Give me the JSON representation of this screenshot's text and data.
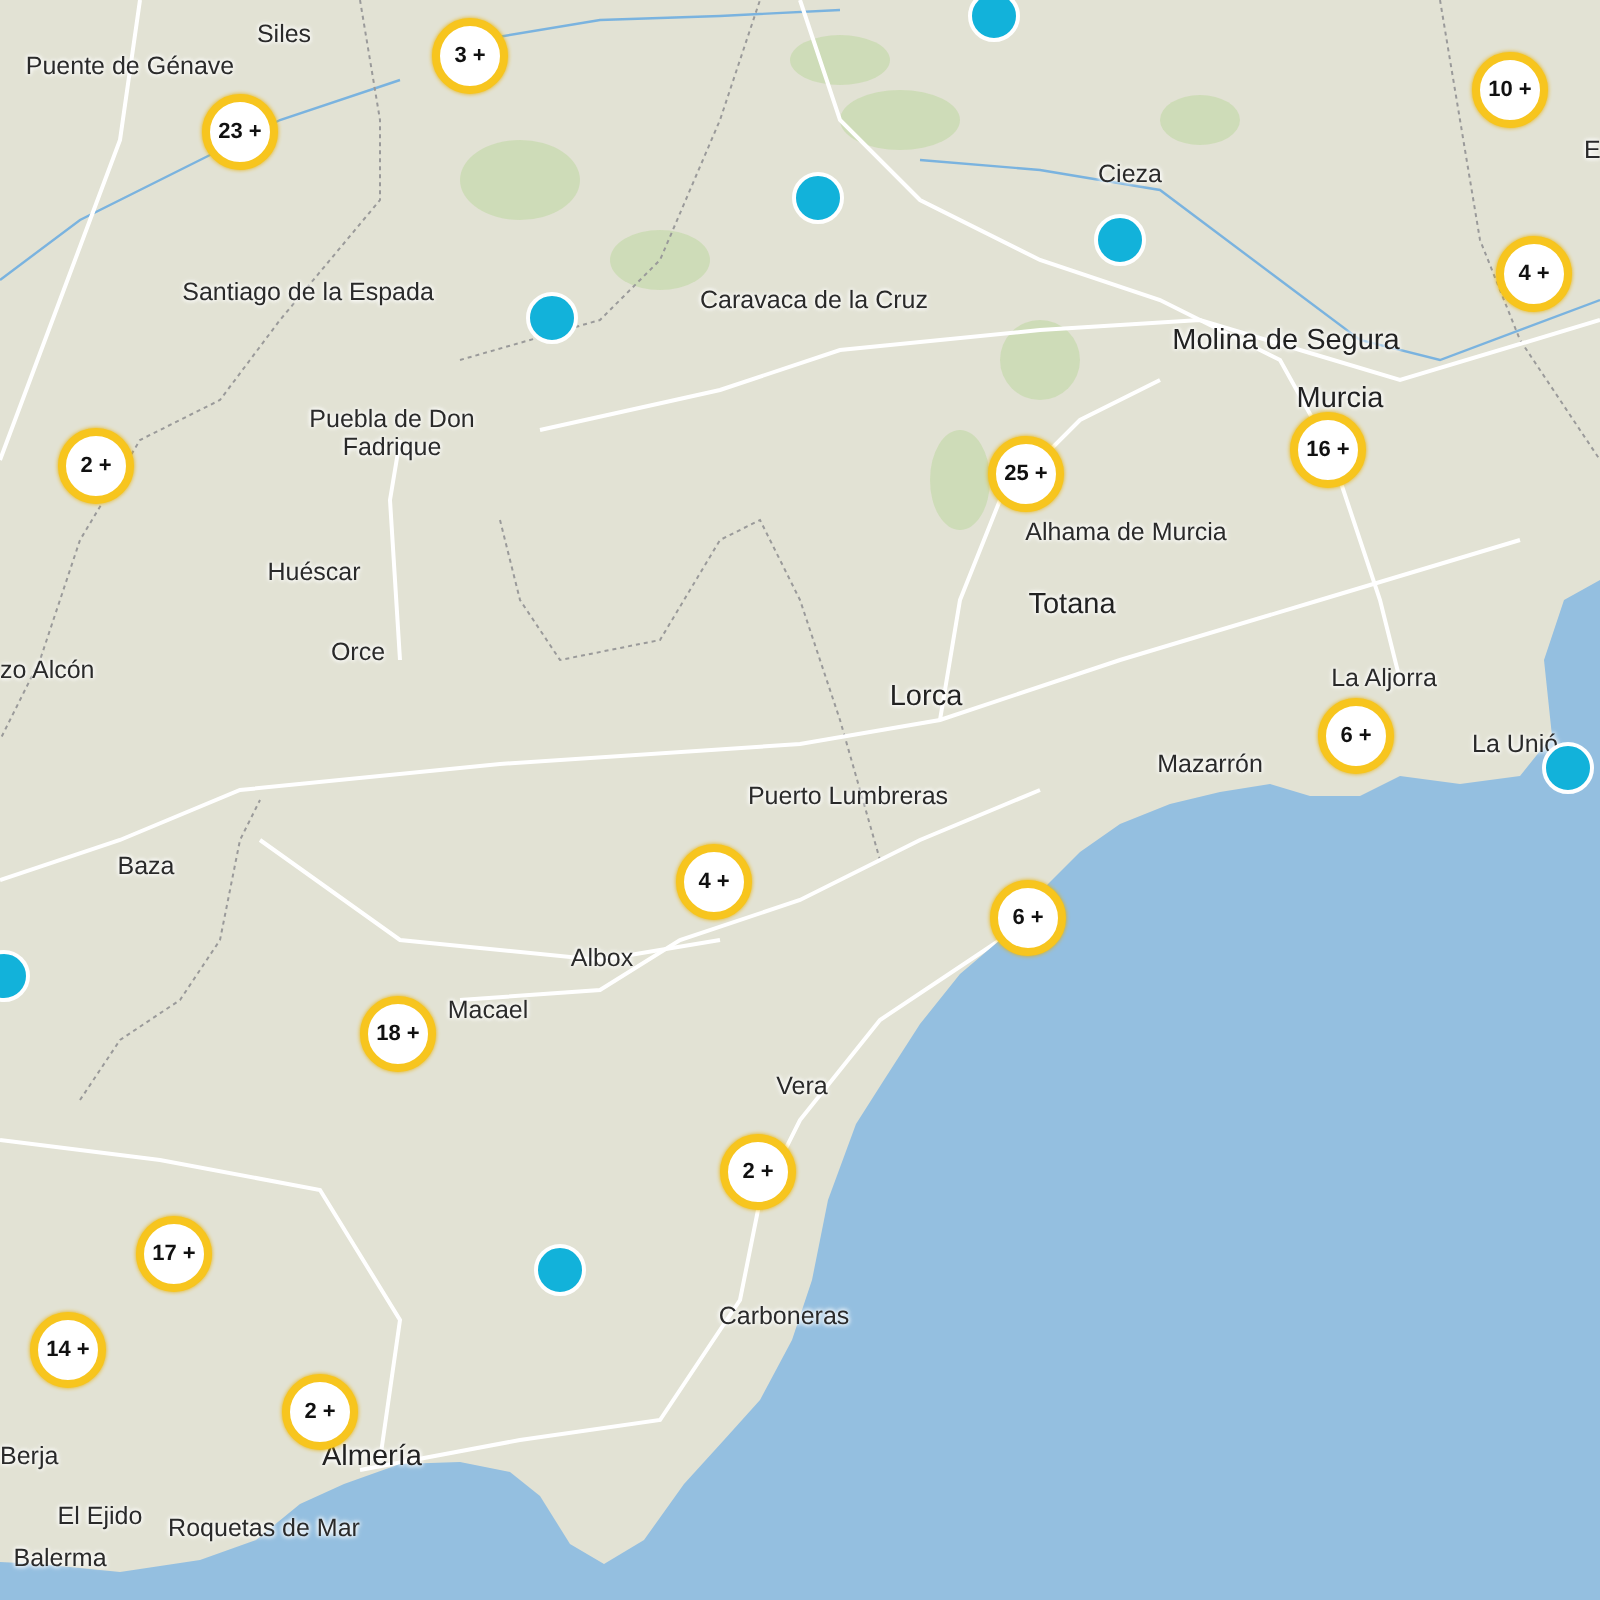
{
  "map": {
    "places": [
      {
        "name": "Siles",
        "kind": "town"
      },
      {
        "name": "Puente de Génave",
        "kind": "town"
      },
      {
        "name": "E",
        "kind": "town"
      },
      {
        "name": "Cieza",
        "kind": "town"
      },
      {
        "name": "Santiago de la Espada",
        "kind": "town"
      },
      {
        "name": "Caravaca de la Cruz",
        "kind": "town"
      },
      {
        "name": "Molina de Segura",
        "kind": "city"
      },
      {
        "name": "Murcia",
        "kind": "city"
      },
      {
        "name": "Puebla de Don\nFadrique",
        "kind": "town"
      },
      {
        "name": "Alhama de Murcia",
        "kind": "town"
      },
      {
        "name": "Huéscar",
        "kind": "town"
      },
      {
        "name": "Totana",
        "kind": "city"
      },
      {
        "name": "Orce",
        "kind": "town"
      },
      {
        "name": "zo Alcón",
        "kind": "town"
      },
      {
        "name": "La Aljorra",
        "kind": "town"
      },
      {
        "name": "Lorca",
        "kind": "city"
      },
      {
        "name": "La Unió",
        "kind": "town"
      },
      {
        "name": "Mazarrón",
        "kind": "town"
      },
      {
        "name": "Puerto Lumbreras",
        "kind": "town"
      },
      {
        "name": "Baza",
        "kind": "town"
      },
      {
        "name": "Albox",
        "kind": "town"
      },
      {
        "name": "Macael",
        "kind": "town"
      },
      {
        "name": "Vera",
        "kind": "town"
      },
      {
        "name": "Carboneras",
        "kind": "town"
      },
      {
        "name": "Berja",
        "kind": "town"
      },
      {
        "name": "Almería",
        "kind": "city"
      },
      {
        "name": "El Ejido",
        "kind": "town"
      },
      {
        "name": "Roquetas de Mar",
        "kind": "town"
      },
      {
        "name": "Balerma",
        "kind": "town"
      }
    ],
    "clusters": [
      {
        "count": "3 +"
      },
      {
        "count": "23 +"
      },
      {
        "count": "10 +"
      },
      {
        "count": "4 +"
      },
      {
        "count": "2 +"
      },
      {
        "count": "25 +"
      },
      {
        "count": "16 +"
      },
      {
        "count": "6 +"
      },
      {
        "count": "4 +"
      },
      {
        "count": "6 +"
      },
      {
        "count": "18 +"
      },
      {
        "count": "2 +"
      },
      {
        "count": "17 +"
      },
      {
        "count": "14 +"
      },
      {
        "count": "2 +"
      }
    ]
  }
}
